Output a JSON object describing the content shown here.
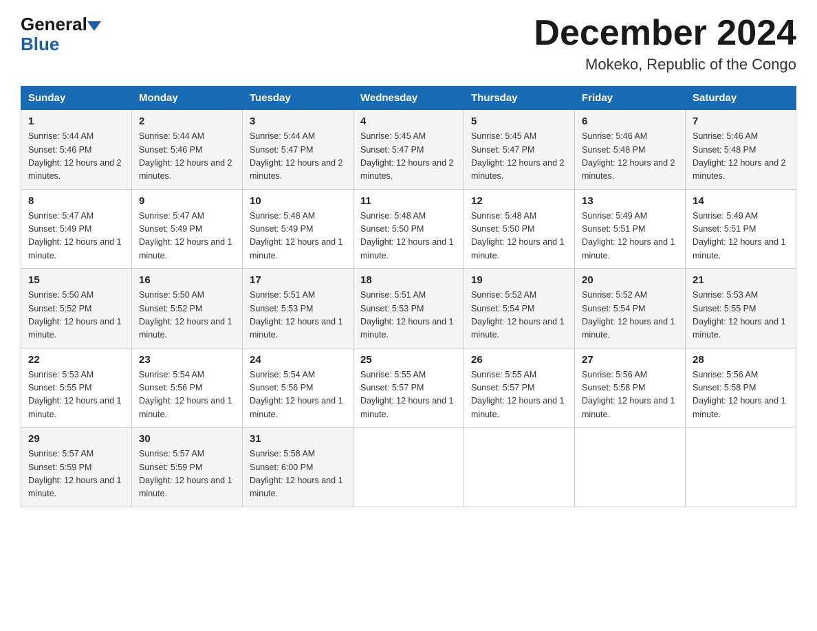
{
  "header": {
    "logo_general": "General",
    "logo_blue": "Blue",
    "month_year": "December 2024",
    "location": "Mokeko, Republic of the Congo"
  },
  "days_of_week": [
    "Sunday",
    "Monday",
    "Tuesday",
    "Wednesday",
    "Thursday",
    "Friday",
    "Saturday"
  ],
  "weeks": [
    [
      {
        "day": "1",
        "sunrise": "5:44 AM",
        "sunset": "5:46 PM",
        "daylight": "12 hours and 2 minutes."
      },
      {
        "day": "2",
        "sunrise": "5:44 AM",
        "sunset": "5:46 PM",
        "daylight": "12 hours and 2 minutes."
      },
      {
        "day": "3",
        "sunrise": "5:44 AM",
        "sunset": "5:47 PM",
        "daylight": "12 hours and 2 minutes."
      },
      {
        "day": "4",
        "sunrise": "5:45 AM",
        "sunset": "5:47 PM",
        "daylight": "12 hours and 2 minutes."
      },
      {
        "day": "5",
        "sunrise": "5:45 AM",
        "sunset": "5:47 PM",
        "daylight": "12 hours and 2 minutes."
      },
      {
        "day": "6",
        "sunrise": "5:46 AM",
        "sunset": "5:48 PM",
        "daylight": "12 hours and 2 minutes."
      },
      {
        "day": "7",
        "sunrise": "5:46 AM",
        "sunset": "5:48 PM",
        "daylight": "12 hours and 2 minutes."
      }
    ],
    [
      {
        "day": "8",
        "sunrise": "5:47 AM",
        "sunset": "5:49 PM",
        "daylight": "12 hours and 1 minute."
      },
      {
        "day": "9",
        "sunrise": "5:47 AM",
        "sunset": "5:49 PM",
        "daylight": "12 hours and 1 minute."
      },
      {
        "day": "10",
        "sunrise": "5:48 AM",
        "sunset": "5:49 PM",
        "daylight": "12 hours and 1 minute."
      },
      {
        "day": "11",
        "sunrise": "5:48 AM",
        "sunset": "5:50 PM",
        "daylight": "12 hours and 1 minute."
      },
      {
        "day": "12",
        "sunrise": "5:48 AM",
        "sunset": "5:50 PM",
        "daylight": "12 hours and 1 minute."
      },
      {
        "day": "13",
        "sunrise": "5:49 AM",
        "sunset": "5:51 PM",
        "daylight": "12 hours and 1 minute."
      },
      {
        "day": "14",
        "sunrise": "5:49 AM",
        "sunset": "5:51 PM",
        "daylight": "12 hours and 1 minute."
      }
    ],
    [
      {
        "day": "15",
        "sunrise": "5:50 AM",
        "sunset": "5:52 PM",
        "daylight": "12 hours and 1 minute."
      },
      {
        "day": "16",
        "sunrise": "5:50 AM",
        "sunset": "5:52 PM",
        "daylight": "12 hours and 1 minute."
      },
      {
        "day": "17",
        "sunrise": "5:51 AM",
        "sunset": "5:53 PM",
        "daylight": "12 hours and 1 minute."
      },
      {
        "day": "18",
        "sunrise": "5:51 AM",
        "sunset": "5:53 PM",
        "daylight": "12 hours and 1 minute."
      },
      {
        "day": "19",
        "sunrise": "5:52 AM",
        "sunset": "5:54 PM",
        "daylight": "12 hours and 1 minute."
      },
      {
        "day": "20",
        "sunrise": "5:52 AM",
        "sunset": "5:54 PM",
        "daylight": "12 hours and 1 minute."
      },
      {
        "day": "21",
        "sunrise": "5:53 AM",
        "sunset": "5:55 PM",
        "daylight": "12 hours and 1 minute."
      }
    ],
    [
      {
        "day": "22",
        "sunrise": "5:53 AM",
        "sunset": "5:55 PM",
        "daylight": "12 hours and 1 minute."
      },
      {
        "day": "23",
        "sunrise": "5:54 AM",
        "sunset": "5:56 PM",
        "daylight": "12 hours and 1 minute."
      },
      {
        "day": "24",
        "sunrise": "5:54 AM",
        "sunset": "5:56 PM",
        "daylight": "12 hours and 1 minute."
      },
      {
        "day": "25",
        "sunrise": "5:55 AM",
        "sunset": "5:57 PM",
        "daylight": "12 hours and 1 minute."
      },
      {
        "day": "26",
        "sunrise": "5:55 AM",
        "sunset": "5:57 PM",
        "daylight": "12 hours and 1 minute."
      },
      {
        "day": "27",
        "sunrise": "5:56 AM",
        "sunset": "5:58 PM",
        "daylight": "12 hours and 1 minute."
      },
      {
        "day": "28",
        "sunrise": "5:56 AM",
        "sunset": "5:58 PM",
        "daylight": "12 hours and 1 minute."
      }
    ],
    [
      {
        "day": "29",
        "sunrise": "5:57 AM",
        "sunset": "5:59 PM",
        "daylight": "12 hours and 1 minute."
      },
      {
        "day": "30",
        "sunrise": "5:57 AM",
        "sunset": "5:59 PM",
        "daylight": "12 hours and 1 minute."
      },
      {
        "day": "31",
        "sunrise": "5:58 AM",
        "sunset": "6:00 PM",
        "daylight": "12 hours and 1 minute."
      },
      null,
      null,
      null,
      null
    ]
  ],
  "labels": {
    "sunrise": "Sunrise:",
    "sunset": "Sunset:",
    "daylight": "Daylight:"
  }
}
